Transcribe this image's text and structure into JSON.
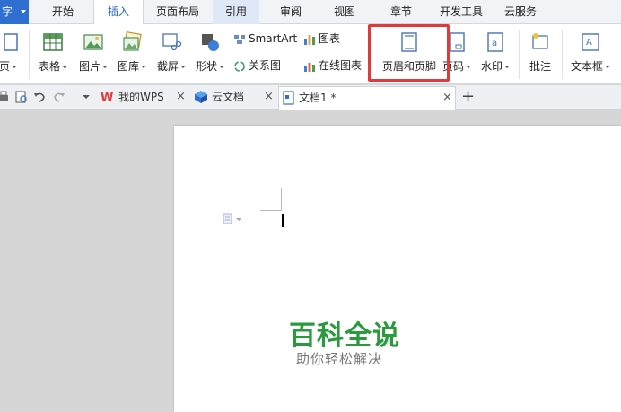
{
  "menubar": {
    "app_label": "字",
    "tabs": [
      "开始",
      "插入",
      "页面布局",
      "引用",
      "审阅",
      "视图",
      "章节",
      "开发工具",
      "云服务"
    ]
  },
  "ribbon": {
    "page_label": "页",
    "table_label": "表格",
    "picture_label": "图片",
    "gallery_label": "图库",
    "screenshot_label": "截屏",
    "shape_label": "形状",
    "smartart_label": "SmartArt",
    "chart_label": "图表",
    "relation_label": "关系图",
    "online_chart_label": "在线图表",
    "header_footer_label": "页眉和页脚",
    "page_number_label": "页码",
    "watermark_label": "水印",
    "comment_label": "批注",
    "textbox_label": "文本框"
  },
  "tabbar": {
    "tabs": [
      {
        "label": "我的WPS"
      },
      {
        "label": "云文档"
      },
      {
        "label": "文档1 *"
      }
    ],
    "add_label": "+"
  },
  "watermark": {
    "title": "百科全说",
    "subtitle": "助你轻松解决"
  },
  "colors": {
    "accent": "#2f6fd0",
    "highlight": "#e03a3a",
    "watermark_green": "#2a9a3c"
  }
}
